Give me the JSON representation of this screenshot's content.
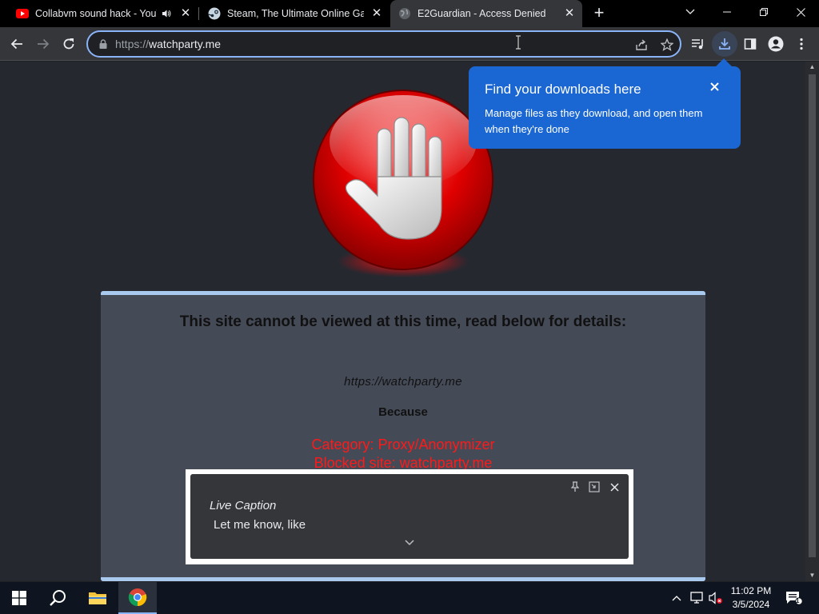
{
  "browser": {
    "tabs": [
      {
        "title": "Collabvm sound hack - YouT",
        "icon": "youtube-icon",
        "audio": true
      },
      {
        "title": "Steam, The Ultimate Online Game",
        "icon": "steam-icon"
      },
      {
        "title": "E2Guardian - Access Denied",
        "icon": "globe-icon",
        "active": true
      }
    ],
    "url_scheme": "https://",
    "url_host": "watchparty.me"
  },
  "downloads_bubble": {
    "title": "Find your downloads here",
    "body": "Manage files as they download, and open them when they're done"
  },
  "page": {
    "heading": "This site cannot be viewed at this time, read below for details:",
    "blocked_url": "https://watchparty.me",
    "because": "Because",
    "category": "Category: Proxy/Anonymizer",
    "blocked_site": "Blocked site: watchparty.me"
  },
  "live_caption": {
    "title": "Live Caption",
    "text": "Let me know, like"
  },
  "taskbar": {
    "time": "11:02 PM",
    "date": "3/5/2024",
    "notification_count": "1"
  },
  "colors": {
    "accent": "#8ab4f8",
    "bubble": "#1a66d2",
    "blocked_red": "#ff1a1a",
    "panel": "#454a57"
  }
}
